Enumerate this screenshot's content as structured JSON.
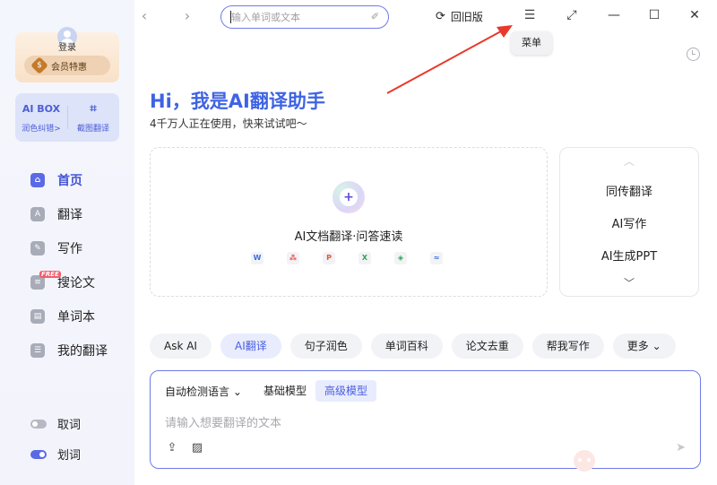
{
  "sidebar": {
    "login_label": "登录",
    "vip_label": "会员特惠",
    "vip_badge": "$",
    "tools": [
      {
        "icon_text": "AI BOX",
        "label": "润色纠错>"
      },
      {
        "icon_text": "⌗",
        "label": "截图翻译"
      }
    ],
    "nav": [
      {
        "label": "首页",
        "icon": "home-icon",
        "glyph": "⌂"
      },
      {
        "label": "翻译",
        "icon": "translate-icon",
        "glyph": "A"
      },
      {
        "label": "写作",
        "icon": "pen-icon",
        "glyph": "✎"
      },
      {
        "label": "搜论文",
        "icon": "paper-icon",
        "glyph": "≡",
        "tag": "FREE"
      },
      {
        "label": "单词本",
        "icon": "wordbook-icon",
        "glyph": "▤"
      },
      {
        "label": "我的翻译",
        "icon": "my-translation-icon",
        "glyph": "☰"
      }
    ],
    "toggles": [
      {
        "label": "取词",
        "on": false
      },
      {
        "label": "划词",
        "on": true
      }
    ]
  },
  "titlebar": {
    "back_glyph": "‹",
    "forward_glyph": "›",
    "search_placeholder": "输入单词或文本",
    "old_version_label": "回旧版",
    "menu_glyph": "☰",
    "restore_glyph": "⤢",
    "min_glyph": "—",
    "max_glyph": "☐",
    "close_glyph": "✕",
    "tooltip": "菜单"
  },
  "main": {
    "greeting": "Hi，我是AI翻译助手",
    "subtitle": "4千万人正在使用，快来试试吧～",
    "doc_title": "AI文档翻译·问答速读",
    "file_types": [
      {
        "glyph": "W",
        "color": "#3b6fe0"
      },
      {
        "glyph": "⁂",
        "color": "#e04b4b"
      },
      {
        "glyph": "P",
        "color": "#e0583b"
      },
      {
        "glyph": "X",
        "color": "#2fa35c"
      },
      {
        "glyph": "◈",
        "color": "#2fa35c"
      },
      {
        "glyph": "≈",
        "color": "#3b6fe0"
      }
    ],
    "side_items": [
      "同传翻译",
      "AI写作",
      "AI生成PPT"
    ],
    "chevron_up": "︿",
    "chevron_down": "﹀",
    "chips": [
      {
        "label": "Ask AI",
        "active": false
      },
      {
        "label": "AI翻译",
        "active": true
      },
      {
        "label": "句子润色",
        "active": false
      },
      {
        "label": "单词百科",
        "active": false
      },
      {
        "label": "论文去重",
        "active": false
      },
      {
        "label": "帮我写作",
        "active": false
      },
      {
        "label": "更多 ⌄",
        "active": false
      }
    ],
    "input_panel": {
      "language": "自动检测语言 ⌄",
      "models": [
        {
          "label": "基础模型",
          "active": false
        },
        {
          "label": "高级模型",
          "active": true
        }
      ],
      "placeholder": "请输入想要翻译的文本"
    }
  },
  "colors": {
    "accent": "#4a5ee2",
    "annotation_arrow": "#e8392b"
  }
}
